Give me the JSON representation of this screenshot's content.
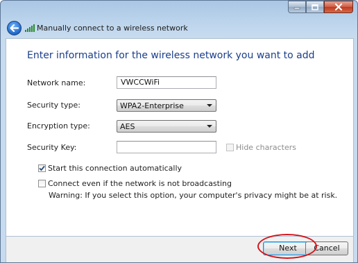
{
  "window": {
    "title": "Manually connect to a wireless network",
    "icon": "wireless-network-icon"
  },
  "caption": {
    "minimize_icon": "minimize-icon",
    "maximize_icon": "maximize-icon",
    "close_icon": "close-icon"
  },
  "nav": {
    "back_icon": "back-arrow-icon"
  },
  "form": {
    "heading": "Enter information for the wireless network you want to add",
    "network_name": {
      "label": "Network name:",
      "value": "VWCCWiFi"
    },
    "security_type": {
      "label": "Security type:",
      "value": "WPA2-Enterprise"
    },
    "encryption_type": {
      "label": "Encryption type:",
      "value": "AES"
    },
    "security_key": {
      "label": "Security Key:",
      "value": ""
    },
    "hide_characters": {
      "label": "Hide characters",
      "checked": false,
      "enabled": false
    },
    "start_automatically": {
      "label": "Start this connection automatically",
      "checked": true
    },
    "connect_not_broadcasting": {
      "label": "Connect even if the network is not broadcasting",
      "checked": false
    },
    "warning": "Warning: If you select this option, your computer's privacy might be at risk."
  },
  "footer": {
    "next_label": "Next",
    "cancel_label": "Cancel"
  },
  "colors": {
    "heading": "#1a3e8c",
    "highlight_oval": "#d3151c",
    "frame": "#bcd4ec"
  }
}
